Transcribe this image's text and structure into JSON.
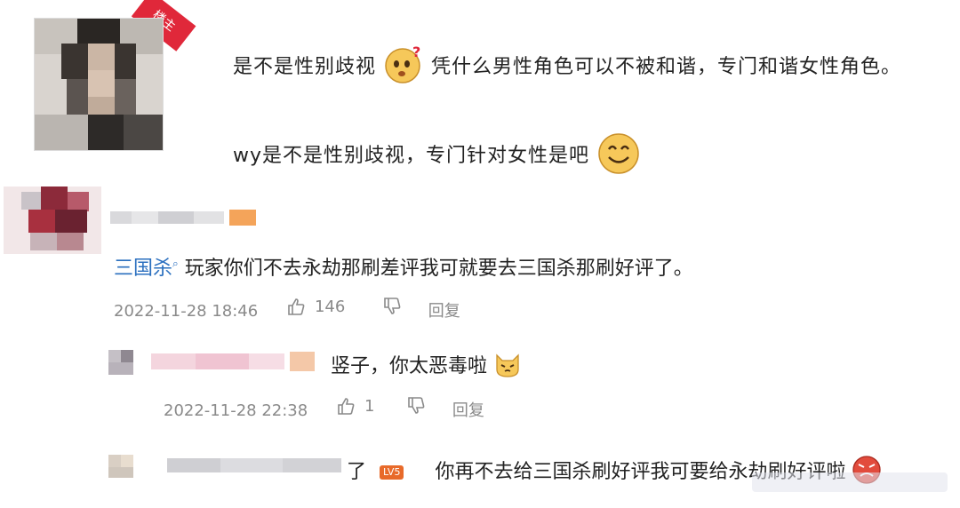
{
  "op": {
    "badge": "楼主",
    "line1_part1": "是不是性别歧视",
    "line1_part2": "凭什么男性角色可以不被和谐，专门和谐女性角色。",
    "line2": "wy是不是性别歧视，专门针对女性是吧",
    "emoji1": "confused-emoji",
    "emoji2": "smile-emoji"
  },
  "comment1": {
    "mention": "三国杀",
    "text": "玩家你们不去永劫那刷差评我可就要去三国杀那刷好评了。",
    "time": "2022-11-28 18:46",
    "likes": "146",
    "reply_label": "回复"
  },
  "reply1": {
    "text": "竖子，你太恶毒啦",
    "time": "2022-11-28 22:38",
    "likes": "1",
    "reply_label": "回复",
    "emoji": "cat-emoji"
  },
  "reply2": {
    "prefix": "了",
    "text": "你再不去给三国杀刷好评我可要给永劫刷好评啦",
    "emoji": "angry-emoji"
  },
  "colors": {
    "link": "#2a6fbf",
    "meta": "#8a8a8a",
    "badge": "#e0283a"
  }
}
